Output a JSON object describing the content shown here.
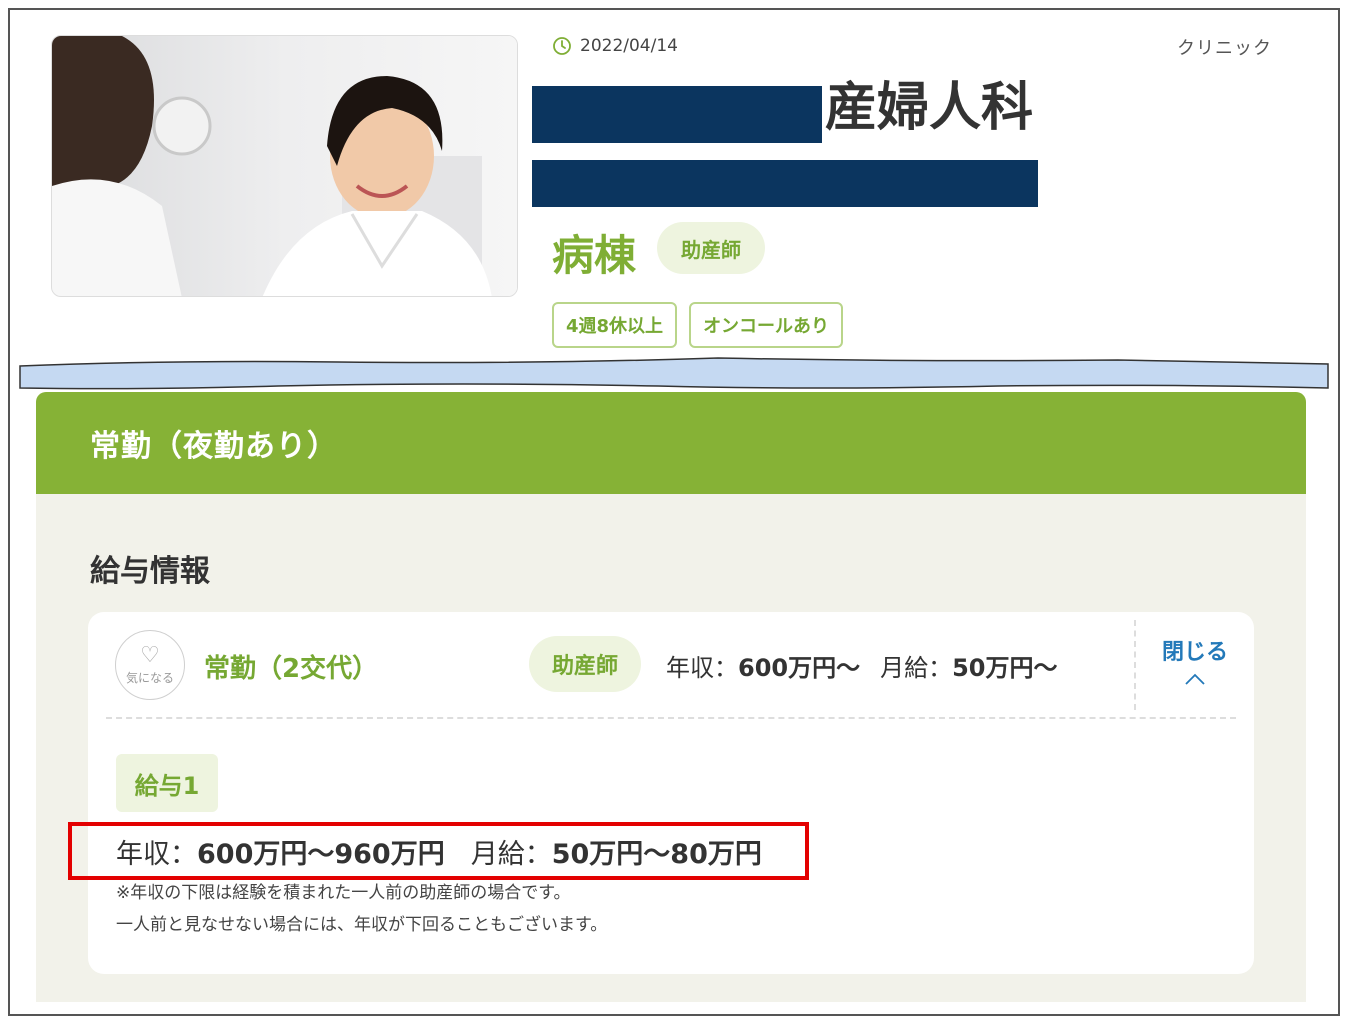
{
  "header": {
    "date": "2022/04/14",
    "category": "クリニック",
    "facility_name_suffix": "産婦人科",
    "ward": "病棟",
    "profession": "助産師",
    "tags": [
      "4週8休以上",
      "オンコールあり"
    ]
  },
  "panel": {
    "title": "常勤（夜勤あり）",
    "section_title": "給与情報",
    "favorite_label": "気になる",
    "job_title": "常勤（2交代）",
    "job_profession": "助産師",
    "summary": {
      "annual_label": "年収：",
      "annual_value": "600万円〜",
      "monthly_label": "月給：",
      "monthly_value": "50万円〜"
    },
    "close_label": "閉じる",
    "salary_item_label": "給与1",
    "detail": {
      "annual_label": "年収：",
      "annual_value": "600万円〜960万円",
      "monthly_label": "月給：",
      "monthly_value": "50万円〜80万円"
    },
    "note_line1": "※年収の下限は経験を積まれた一人前の助産師の場合です。",
    "note_line2": "一人前と見なせない場合には、年収が下回ることもございます。"
  },
  "colors": {
    "accent_green": "#86b236",
    "redaction": "#0b355f",
    "highlight": "#e30000",
    "link_blue": "#2379b9"
  }
}
